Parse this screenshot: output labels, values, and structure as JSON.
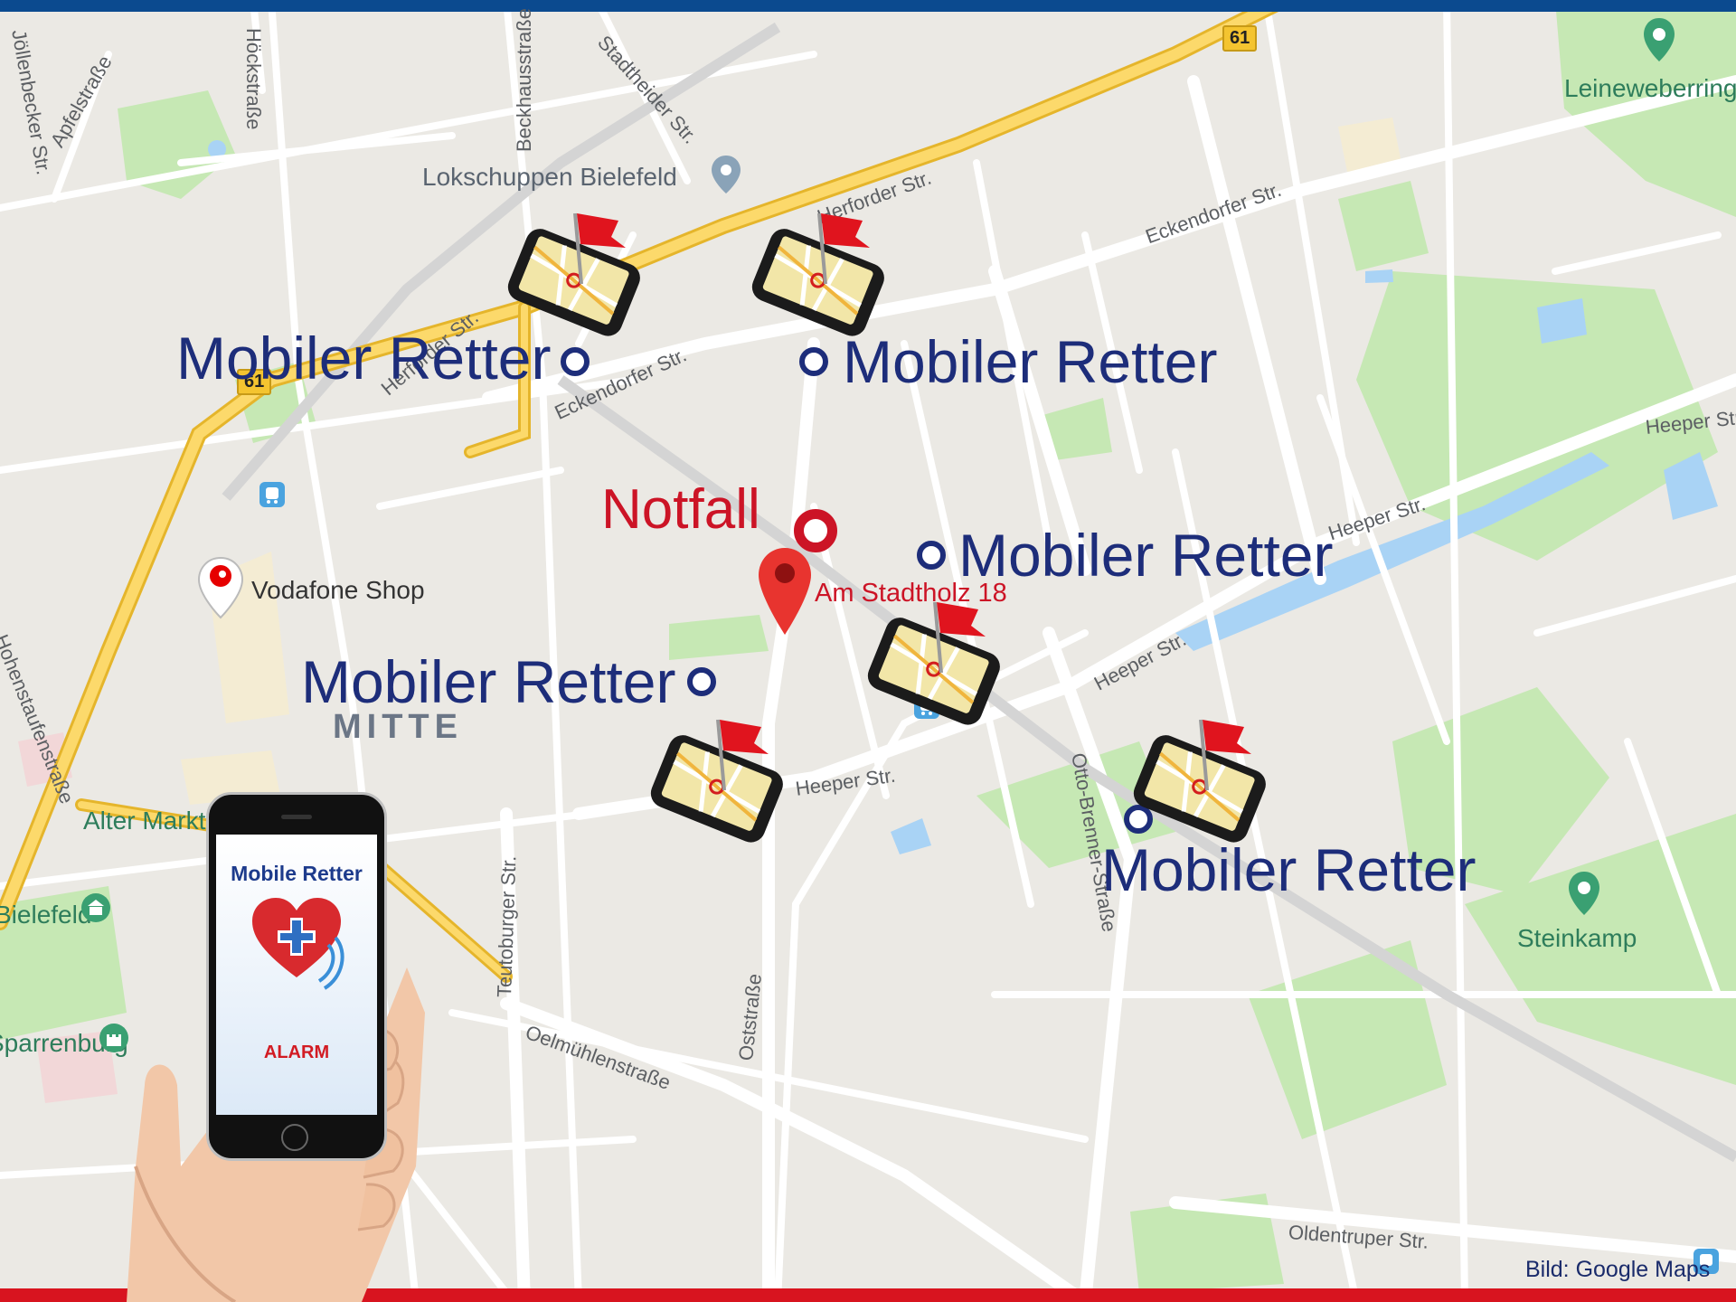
{
  "labels": {
    "retter": "Mobiler Retter",
    "notfall": "Notfall",
    "address": "Am Stadtholz 18",
    "credit": "Bild: Google Maps",
    "district": "MITTE"
  },
  "pois": {
    "lokschuppen": "Lokschuppen Bielefeld",
    "vodafone": "Vodafone Shop",
    "leineweber": "Leineweberring",
    "steinkamp": "Steinkamp",
    "alter_markt": "Alter Markt",
    "bielefeld": "Bielefeld",
    "sparrenburg": "Sparrenburg"
  },
  "streets": {
    "herforder": "Herforder Str.",
    "eckendorfer": "Eckendorfer Str.",
    "heeper": "Heeper Str.",
    "oelmuehlen": "Oelmühlenstraße",
    "oststrasse": "Oststraße",
    "teutoburger": "Teutoburger Str.",
    "otto_brenner": "Otto-Brenner-Straße",
    "oldentruper": "Oldentruper Str.",
    "beckhaus": "Beckhausstraße",
    "stadtheider": "Stadtheider Str.",
    "apfel": "Apfelstraße",
    "jollenbecker": "Jöllenbecker Str.",
    "hohenstaufen": "Hohenstaufenstraße",
    "hoe": "Höckstraße"
  },
  "highway": "61",
  "app": {
    "name": "Mobile Retter",
    "alarm": "ALARM"
  },
  "colors": {
    "retter_text": "#1d2d7a",
    "notfall": "#cc1426",
    "top_bar": "#0b4a8f",
    "bottom_bar": "#d8141f"
  }
}
